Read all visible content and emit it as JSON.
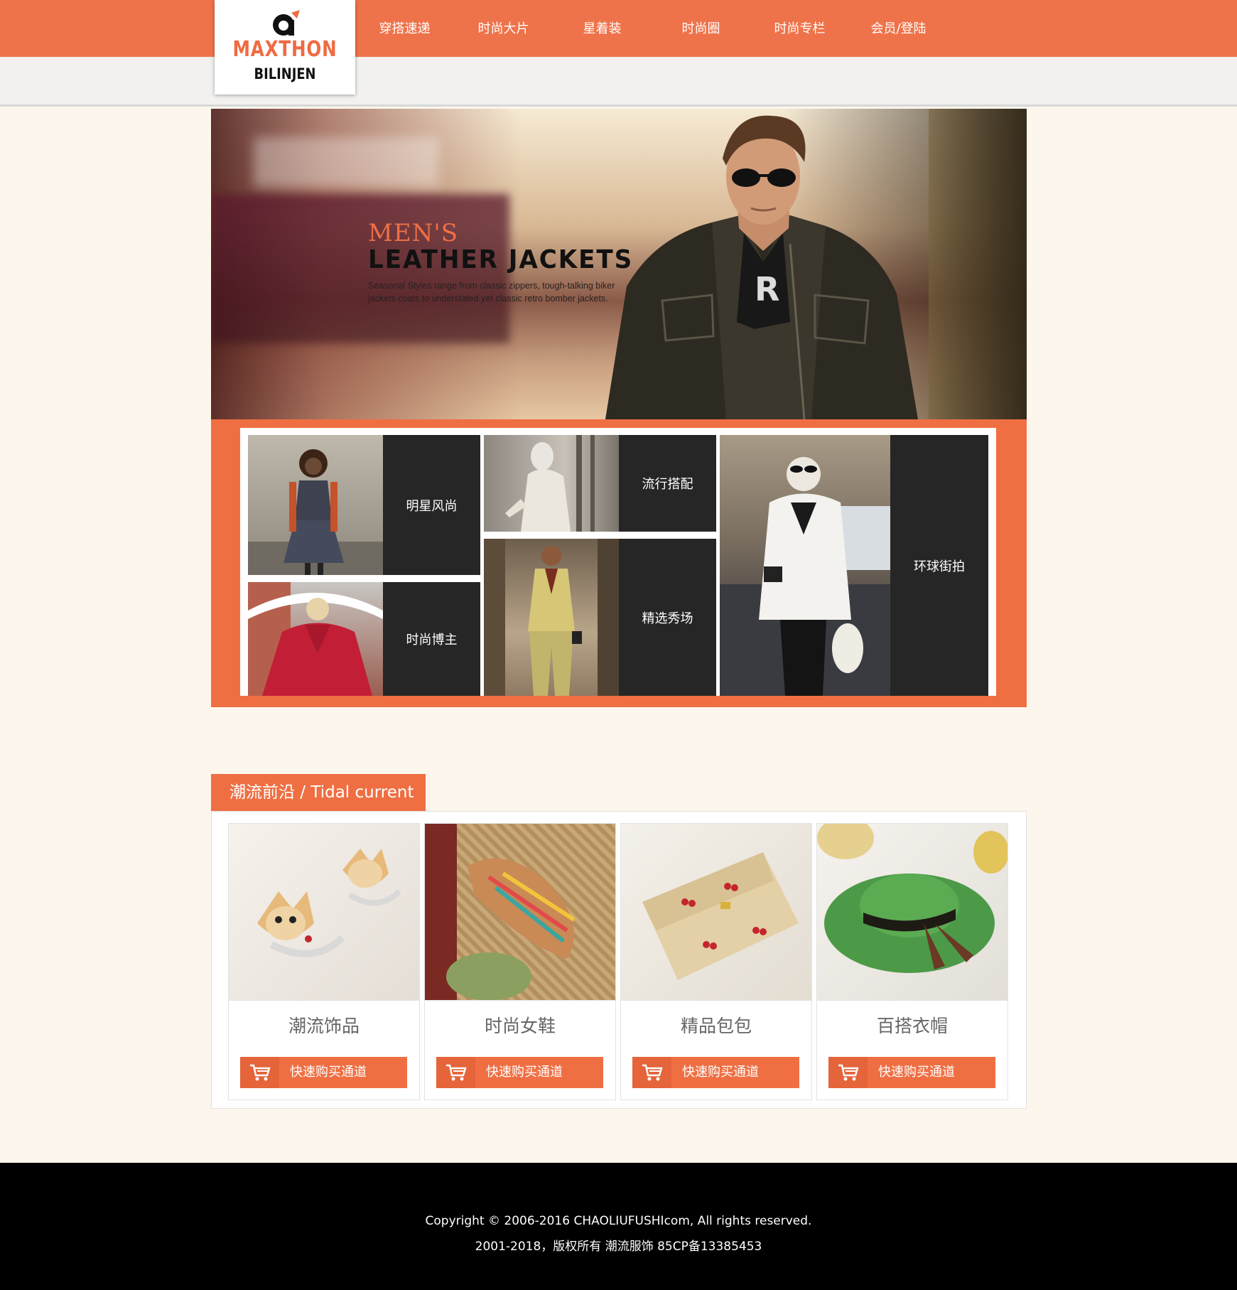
{
  "brand": {
    "name": "MAXTHON",
    "sub": "BILINJEN"
  },
  "nav": [
    {
      "label": "穿搭速递"
    },
    {
      "label": "时尚大片"
    },
    {
      "label": "星着装"
    },
    {
      "label": "时尚圈"
    },
    {
      "label": "时尚专栏"
    },
    {
      "label": "会员/登陆"
    }
  ],
  "banner": {
    "kicker": "MEN'S",
    "headline": "LEATHER JACKETS",
    "description": "Seasonal Styles range from classic zippers, tough-talking biker jackets coats to understated yet classic retro bomber jackets."
  },
  "categories": [
    {
      "label": "明星风尚"
    },
    {
      "label": "流行搭配"
    },
    {
      "label": "环球街拍"
    },
    {
      "label": "时尚博主"
    },
    {
      "label": "精选秀场"
    }
  ],
  "section": {
    "title": "潮流前沿 / Tidal current",
    "buy_label": "快速购买通道",
    "products": [
      {
        "title": "潮流饰品"
      },
      {
        "title": "时尚女鞋"
      },
      {
        "title": "精品包包"
      },
      {
        "title": "百搭衣帽"
      }
    ]
  },
  "footer": {
    "copyright": "Copyright © 2006-2016 CHAOLIUFUSHIcom, All rights reserved.",
    "record": "2001-2018，版权所有 潮流服饰 85CP备13385453"
  },
  "colors": {
    "accent": "#ef6f43",
    "tile_dark": "#262626",
    "page_bg": "#fdf6ec"
  },
  "icons": [
    "logo-mark-icon",
    "shopping-cart-icon"
  ]
}
